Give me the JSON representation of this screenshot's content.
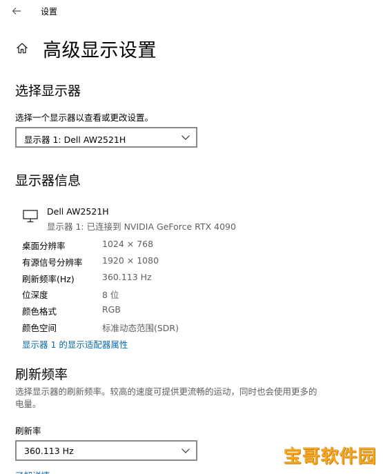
{
  "window": {
    "title": "设置"
  },
  "page": {
    "title": "高级显示设置"
  },
  "select_display": {
    "heading": "选择显示器",
    "description": "选择一个显示器以查看或更改设置。",
    "selected": "显示器 1: Dell AW2521H"
  },
  "display_info": {
    "heading": "显示器信息",
    "monitor_name": "Dell AW2521H",
    "monitor_sub": "显示器 1: 已连接到 NVIDIA GeForce RTX 4090",
    "rows": [
      {
        "label": "桌面分辨率",
        "value": "1024 × 768"
      },
      {
        "label": "有源信号分辨率",
        "value": "1920 × 1080"
      },
      {
        "label": "刷新频率(Hz)",
        "value": "360.113 Hz"
      },
      {
        "label": "位深度",
        "value": "8 位"
      },
      {
        "label": "颜色格式",
        "value": "RGB"
      },
      {
        "label": "颜色空间",
        "value": "标准动态范围(SDR)"
      }
    ],
    "adapter_link": "显示器 1 的显示适配器属性"
  },
  "refresh": {
    "heading": "刷新频率",
    "description": "选择显示器的刷新频率。较高的速度可提供更流畅的运动，同时也会使用更多的电量。",
    "field_label": "刷新率",
    "selected": "360.113 Hz",
    "more_link": "了解详情"
  },
  "watermark": {
    "text": "宝哥软件园"
  },
  "icons": {
    "back": "back-arrow-icon",
    "home": "home-icon",
    "monitor": "monitor-icon",
    "chevron": "chevron-down-icon"
  },
  "colors": {
    "link": "#0b6aa8",
    "secondary_text": "#5f5f5f",
    "border": "#8a8a8a",
    "watermark": "#f5a623"
  }
}
